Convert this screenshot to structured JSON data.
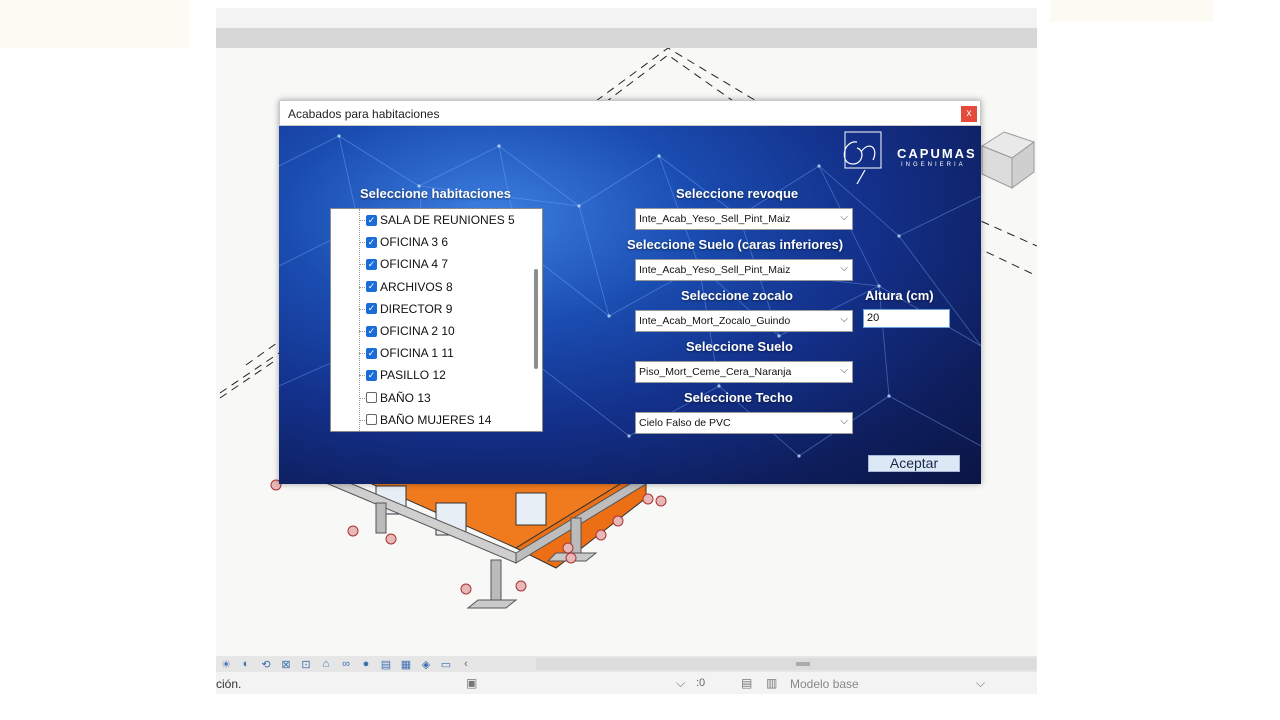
{
  "dialog": {
    "title": "Acabados para habitaciones",
    "close_label": "x",
    "rooms_label": "Seleccione habitaciones",
    "rooms": [
      {
        "name": "SALA DE REUNIONES 5",
        "checked": true
      },
      {
        "name": "OFICINA 3 6",
        "checked": true
      },
      {
        "name": "OFICINA 4 7",
        "checked": true
      },
      {
        "name": "ARCHIVOS 8",
        "checked": true
      },
      {
        "name": "DIRECTOR 9",
        "checked": true
      },
      {
        "name": "OFICINA 2 10",
        "checked": true
      },
      {
        "name": "OFICINA 1 11",
        "checked": true
      },
      {
        "name": "PASILLO 12",
        "checked": true
      },
      {
        "name": "BAÑO 13",
        "checked": false
      },
      {
        "name": "BAÑO MUJERES 14",
        "checked": false
      }
    ],
    "revoque_label": "Seleccione revoque",
    "revoque_value": "Inte_Acab_Yeso_Sell_Pint_Maiz",
    "suelo_inf_label": "Seleccione Suelo (caras inferiores)",
    "suelo_inf_value": "Inte_Acab_Yeso_Sell_Pint_Maiz",
    "zocalo_label": "Seleccione zocalo",
    "zocalo_value": "Inte_Acab_Mort_Zocalo_Guindo",
    "altura_label": "Altura (cm)",
    "altura_value": "20",
    "suelo_label": "Seleccione Suelo",
    "suelo_value": "Piso_Mort_Ceme_Cera_Naranja",
    "techo_label": "Seleccione Techo",
    "techo_value": "Cielo Falso de PVC",
    "accept_label": "Aceptar",
    "logo_text": "CAPUMAS",
    "logo_subtext": "INGENIERIA"
  },
  "status_bar": {
    "text": "ción.",
    "zero": ":0",
    "model": "Modelo base"
  },
  "colors": {
    "dialog_background": "#13308a",
    "close_button": "#e64a3b",
    "checkbox_checked": "#1a6dd8",
    "building_orange": "#f07a1e"
  }
}
